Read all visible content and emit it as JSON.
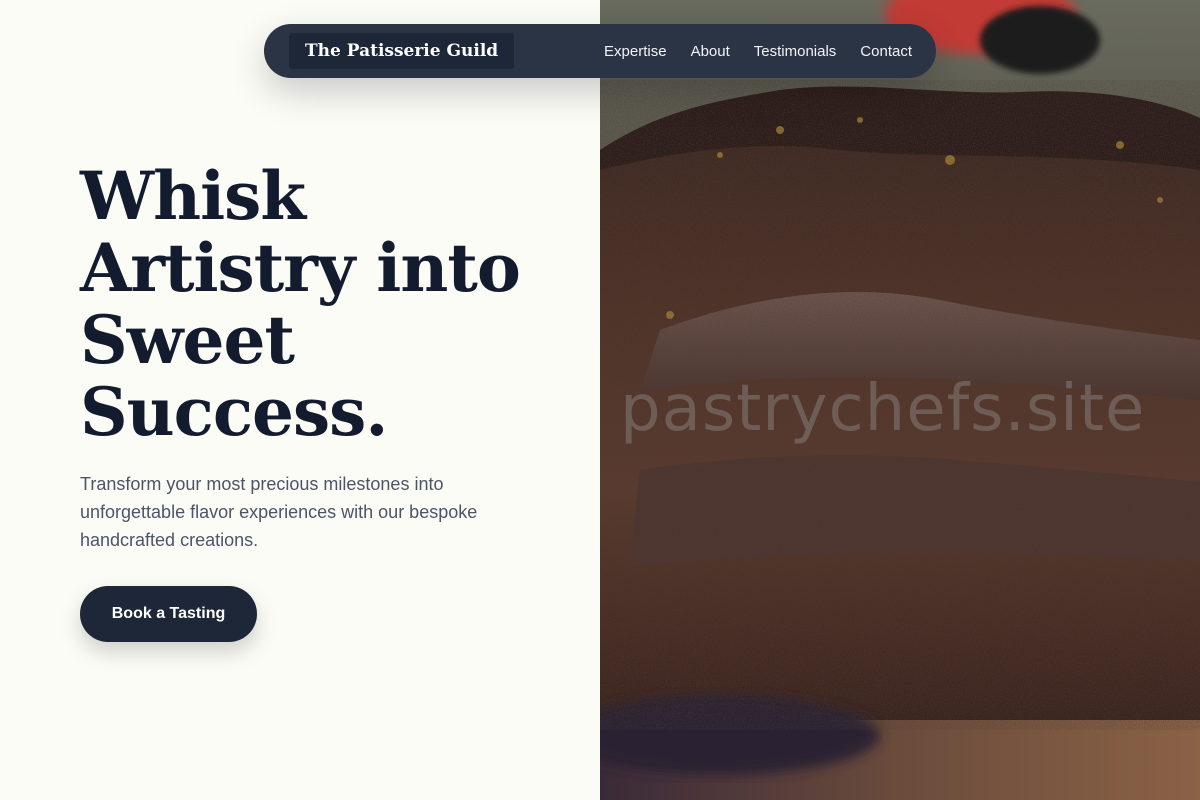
{
  "nav": {
    "brand": "The Patisserie Guild",
    "links": [
      {
        "label": "Expertise"
      },
      {
        "label": "About"
      },
      {
        "label": "Testimonials"
      },
      {
        "label": "Contact"
      }
    ]
  },
  "hero": {
    "title_lines": [
      "Whisk",
      "Artistry into",
      "Sweet",
      "Success."
    ],
    "subtitle": "Transform your most precious milestones into unforgettable flavor experiences with our bespoke handcrafted creations.",
    "cta_label": "Book a Tasting"
  },
  "image": {
    "subject": "chocolate-layer-cake-photo",
    "watermark": "pastrychefs.site"
  },
  "colors": {
    "background": "#fcfcf7",
    "navbar": "#2b3445",
    "brand_bg": "#1e2738",
    "heading": "#131b2e",
    "body_text": "#4b5567",
    "button": "#1e2738",
    "button_text": "#ffffff"
  }
}
